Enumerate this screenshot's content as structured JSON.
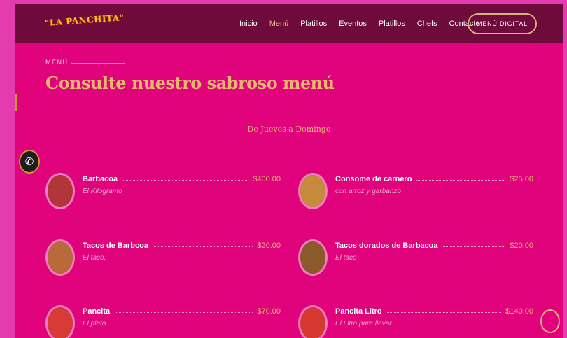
{
  "header": {
    "logo_text": "\"LA PANCHITA\"",
    "nav": [
      "Inicio",
      "Menú",
      "Platillos",
      "Eventos",
      "Platillos",
      "Chefs",
      "Contacto"
    ],
    "active_nav": "Menú",
    "cta_label": "MENÚ DIGITAL"
  },
  "section": {
    "eyebrow": "MENÚ",
    "title": "Consulte nuestro sabroso menú",
    "subtitle": "De Jueves a Domingo"
  },
  "menu_items": [
    {
      "name": "Barbacoa",
      "desc": "El Kilogramo",
      "price": "$400.00",
      "thumb": "#b0363a"
    },
    {
      "name": "Consome de carnero",
      "desc": "con arroz y garbanzo",
      "price": "$25.00",
      "thumb": "#c58a3c"
    },
    {
      "name": "Tacos de Barbcoa",
      "desc": "El taco.",
      "price": "$20.00",
      "thumb": "#b86a3a"
    },
    {
      "name": "Tacos dorados de Barbacoa",
      "desc": "El taco",
      "price": "$20.00",
      "thumb": "#8c5a2a"
    },
    {
      "name": "Pancita",
      "desc": "El plato.",
      "price": "$70.00",
      "thumb": "#d83a35"
    },
    {
      "name": "Pancita Litro",
      "desc": "El Litro para llevar.",
      "price": "$140.00",
      "thumb": "#d6392f"
    }
  ],
  "icons": {
    "whatsapp": "whatsapp-icon"
  },
  "colors": {
    "background": "#e1037b",
    "header": "#6e0b3a",
    "accent": "#e6b86e"
  }
}
